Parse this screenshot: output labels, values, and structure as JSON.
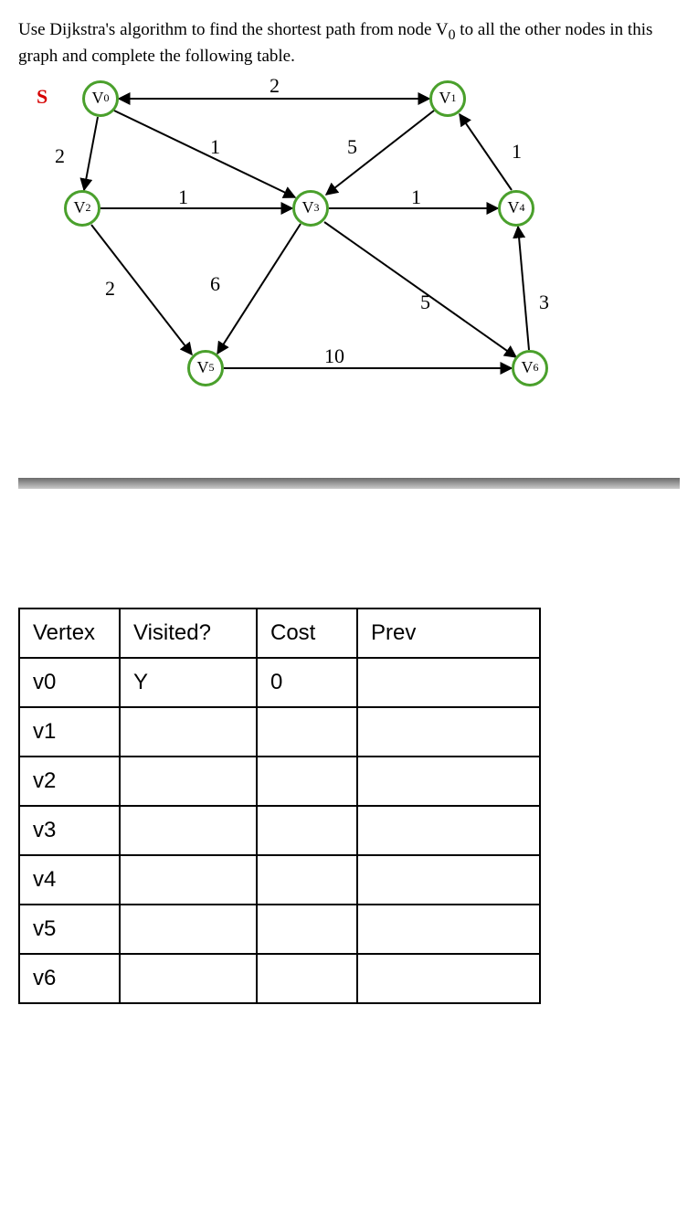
{
  "prompt_html": "Use Dijkstra's algorithm to find the shortest path from node V<sub>0</sub> to all the other nodes in this graph and complete the following table.",
  "s_label": "S",
  "nodes": {
    "v0": "V0",
    "v1": "V1",
    "v2": "V2",
    "v3": "V3",
    "v4": "V4",
    "v5": "V5",
    "v6": "V6"
  },
  "chart_data": {
    "type": "graph",
    "directed": true,
    "source": "V0",
    "vertices": [
      "V0",
      "V1",
      "V2",
      "V3",
      "V4",
      "V5",
      "V6"
    ],
    "edges": [
      {
        "from": "V0",
        "to": "V1",
        "w": 2
      },
      {
        "from": "V0",
        "to": "V2",
        "w": 2
      },
      {
        "from": "V0",
        "to": "V3",
        "w": 1
      },
      {
        "from": "V1",
        "to": "V0",
        "w": 2
      },
      {
        "from": "V1",
        "to": "V3",
        "w": 5
      },
      {
        "from": "V2",
        "to": "V3",
        "w": 1
      },
      {
        "from": "V2",
        "to": "V5",
        "w": 2
      },
      {
        "from": "V3",
        "to": "V4",
        "w": 1
      },
      {
        "from": "V3",
        "to": "V5",
        "w": 6
      },
      {
        "from": "V3",
        "to": "V6",
        "w": 5
      },
      {
        "from": "V4",
        "to": "V1",
        "w": 1
      },
      {
        "from": "V5",
        "to": "V6",
        "w": 10
      },
      {
        "from": "V6",
        "to": "V4",
        "w": 3
      }
    ]
  },
  "edge_weights": {
    "e_v0_v1": "2",
    "e_v0_v2": "2",
    "e_v0_v3": "1",
    "e_v1_v3": "5",
    "e_v2_v3": "1",
    "e_v2_v5": "2",
    "e_v3_v4": "1",
    "e_v3_v5": "6",
    "e_v3_v6": "5",
    "e_v4_v1": "1",
    "e_v5_v6": "10",
    "e_v6_v4": "3"
  },
  "table": {
    "headers": {
      "vertex": "Vertex",
      "visited": "Visited?",
      "cost": "Cost",
      "prev": "Prev"
    },
    "rows": [
      {
        "vertex": "v0",
        "visited": "Y",
        "cost": "0",
        "prev": ""
      },
      {
        "vertex": "v1",
        "visited": "",
        "cost": "",
        "prev": ""
      },
      {
        "vertex": "v2",
        "visited": "",
        "cost": "",
        "prev": ""
      },
      {
        "vertex": "v3",
        "visited": "",
        "cost": "",
        "prev": ""
      },
      {
        "vertex": "v4",
        "visited": "",
        "cost": "",
        "prev": ""
      },
      {
        "vertex": "v5",
        "visited": "",
        "cost": "",
        "prev": ""
      },
      {
        "vertex": "v6",
        "visited": "",
        "cost": "",
        "prev": ""
      }
    ]
  }
}
